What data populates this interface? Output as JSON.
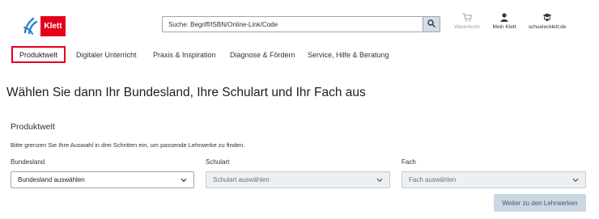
{
  "header": {
    "logo_text": "Klett",
    "search": {
      "placeholder": "Suche: Begriff/ISBN/Online-Link/Code"
    },
    "utilities": {
      "cart": "Warenkorb",
      "account": "Mein Klett",
      "school": "schuelecklett.de"
    }
  },
  "nav": {
    "items": [
      {
        "label": "Produktwelt",
        "active": true
      },
      {
        "label": "Digitaler Unterricht"
      },
      {
        "label": "Praxis & Inspiration"
      },
      {
        "label": "Diagnose & Fördern"
      },
      {
        "label": "Service, Hilfe & Beratung"
      }
    ]
  },
  "main": {
    "title": "Wählen Sie dann Ihr Bundesland, Ihre Schulart und Ihr Fach aus",
    "section_title": "Produktwelt",
    "hint": "Bitte grenzen Sie Ihre Auswahl in drei Schritten ein, um passende Lehrwerke zu finden.",
    "fields": [
      {
        "label": "Bundesland",
        "value": "Bundesland auswählen",
        "enabled": true
      },
      {
        "label": "Schulart",
        "value": "Schulart auswählen",
        "enabled": false
      },
      {
        "label": "Fach",
        "value": "Fach auswählen",
        "enabled": false
      }
    ],
    "submit_label": "Weiter zu den Lehrwerken"
  },
  "colors": {
    "brand": "#e2001a",
    "border": "#9aa6b4",
    "disabled_bg": "#edf0f3",
    "button_bg": "#cbd7e2"
  }
}
